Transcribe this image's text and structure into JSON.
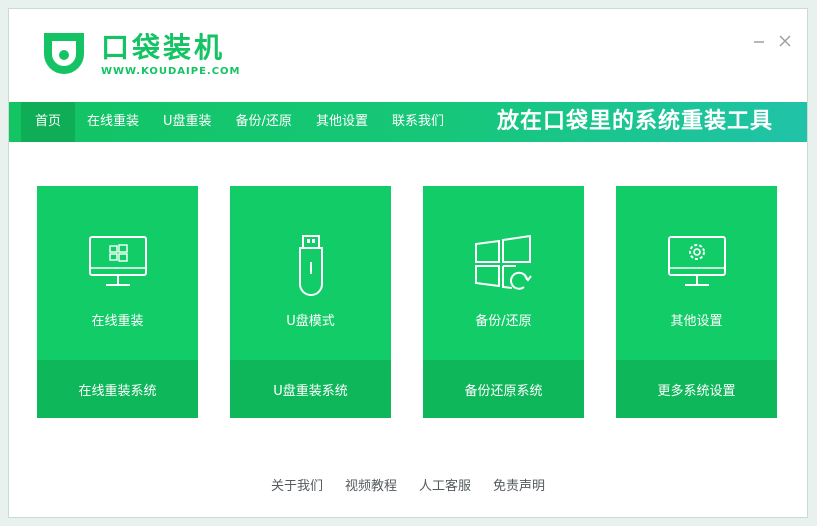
{
  "app": {
    "title": "口袋装机",
    "url": "WWW.KOUDAIPE.COM",
    "brand_color": "#14c464"
  },
  "window_controls": {
    "minimize_icon": "minus-icon",
    "close_icon": "close-icon"
  },
  "nav": {
    "items": [
      {
        "label": "首页",
        "active": true
      },
      {
        "label": "在线重装"
      },
      {
        "label": "U盘重装"
      },
      {
        "label": "备份/还原"
      },
      {
        "label": "其他设置"
      },
      {
        "label": "联系我们"
      }
    ],
    "slogan": "放在口袋里的系统重装工具"
  },
  "cards": [
    {
      "icon": "monitor-windows-icon",
      "title": "在线重装",
      "action": "在线重装系统"
    },
    {
      "icon": "usb-drive-icon",
      "title": "U盘模式",
      "action": "U盘重装系统"
    },
    {
      "icon": "windows-restore-icon",
      "title": "备份/还原",
      "action": "备份还原系统"
    },
    {
      "icon": "monitor-gear-icon",
      "title": "其他设置",
      "action": "更多系统设置"
    }
  ],
  "footer": {
    "links": [
      "关于我们",
      "视频教程",
      "人工客服",
      "免责声明"
    ]
  }
}
